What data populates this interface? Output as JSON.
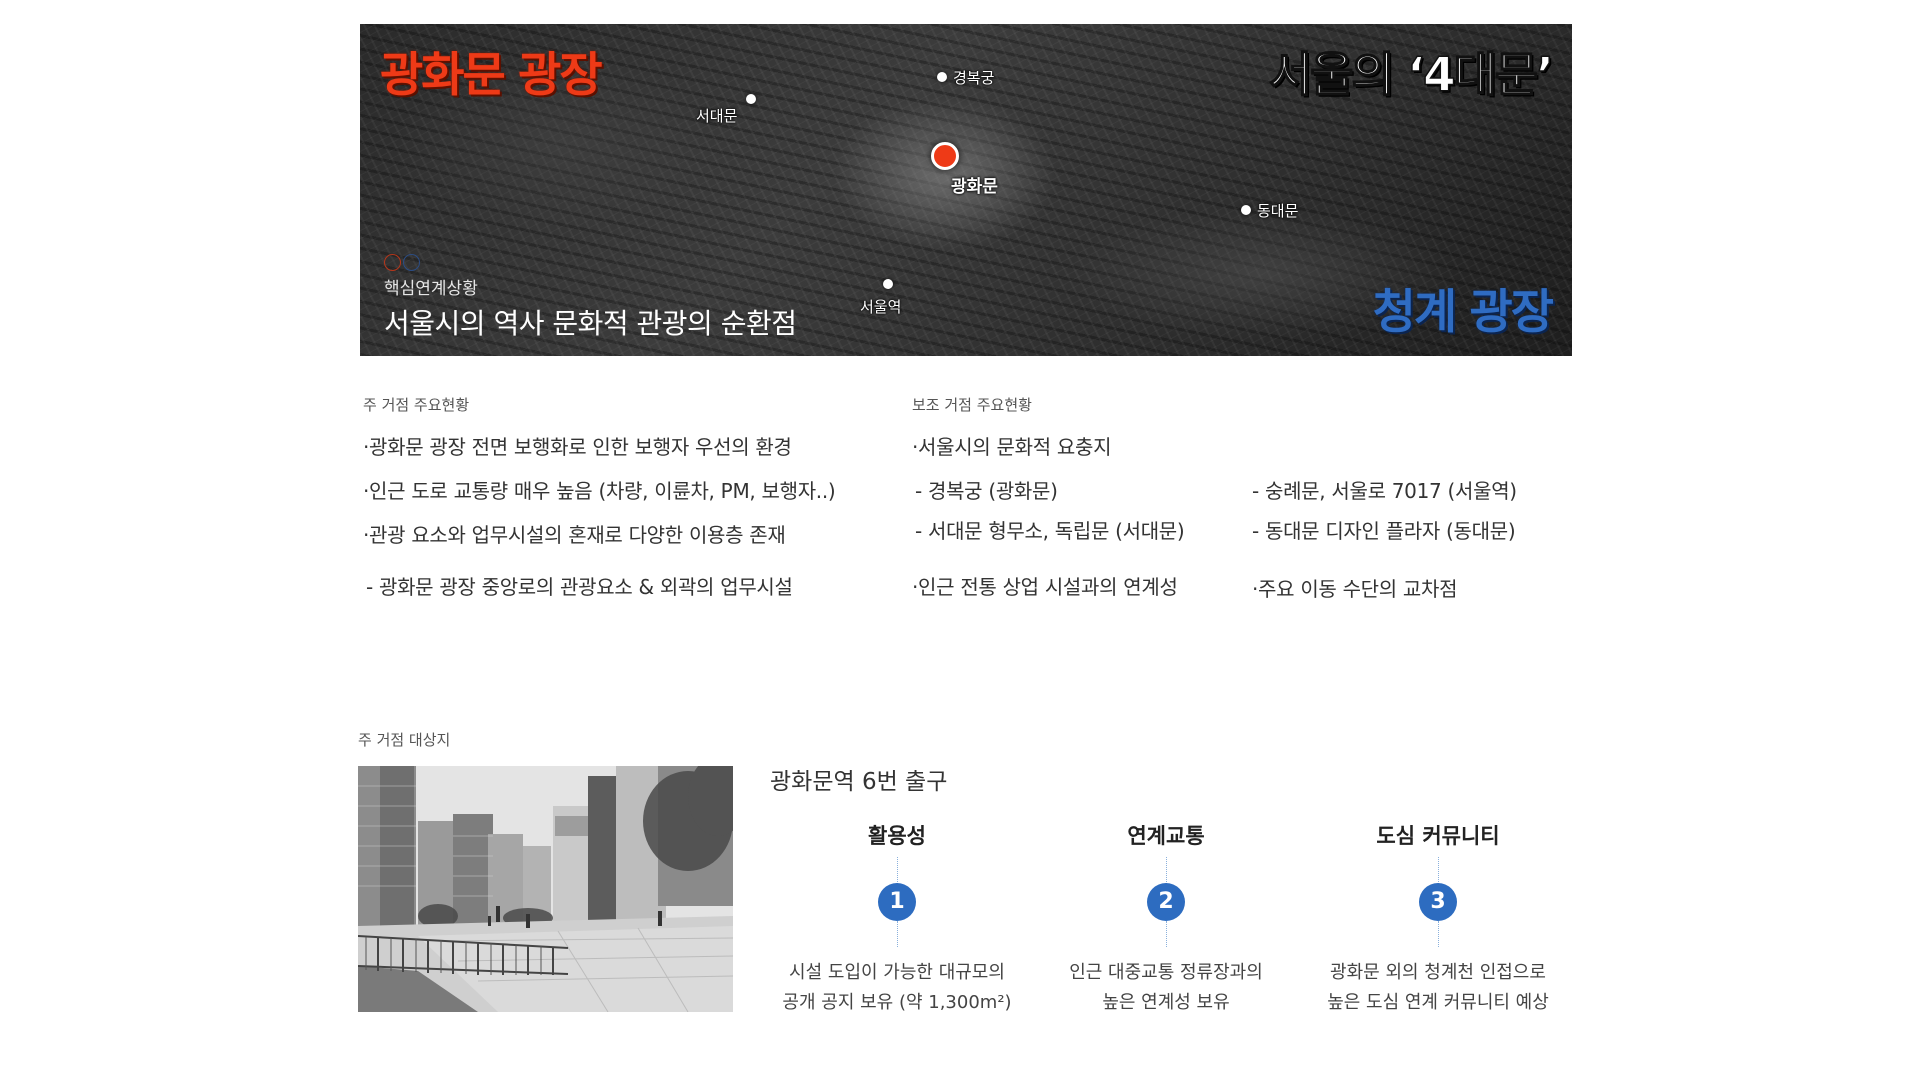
{
  "hero": {
    "title_left": "광화문 광장",
    "title_right": "서울의 ‘4대문’",
    "title_bottom": "청계 광장",
    "locations": {
      "gyeongbokgung": "경복궁",
      "seodaemun": "서대문",
      "gwanghwamun": "광화문",
      "dongdaemun": "동대문",
      "seoul_station": "서울역"
    },
    "subtitle": "핵심연계상황",
    "main_text": "서울시의 역사 문화적 관광의 순환점",
    "colors": {
      "accent_red": "#ee3a17",
      "accent_blue": "#2f6cc2"
    }
  },
  "main_status": {
    "label": "주 거점 주요현황",
    "lines": [
      "·광화문 광장 전면 보행화로 인한 보행자 우선의 환경",
      "·인근 도로 교통량 매우 높음 (차량, 이륜차, PM, 보행자..)",
      "·관광 요소와 업무시설의 혼재로 다양한 이용층 존재",
      "- 광화문 광장 중앙로의 관광요소 & 외곽의 업무시설"
    ]
  },
  "sub_status": {
    "label": "보조 거점 주요현황",
    "heading": "·서울시의 문화적 요충지",
    "items": [
      "- 경복궁 (광화문)",
      "- 서대문 형무소, 독립문 (서대문)",
      "- 숭례문, 서울로 7017 (서울역)",
      "- 동대문 디자인 플라자 (동대문)"
    ],
    "bottom_left": "·인근 전통 상업 시설과의 연계성",
    "bottom_right": "·주요 이동 수단의 교차점"
  },
  "site": {
    "label": "주 거점 대상지",
    "exit_title": "광화문역 6번 출구",
    "features": [
      {
        "num": "1",
        "title": "활용성",
        "desc1": "시설 도입이 가능한 대규모의",
        "desc2": "공개 공지 보유 (약 1,300m²)"
      },
      {
        "num": "2",
        "title": "연계교통",
        "desc1": "인근 대중교통 정류장과의",
        "desc2": "높은 연계성 보유"
      },
      {
        "num": "3",
        "title": "도심 커뮤니티",
        "desc1": "광화문 외의 청계천 인접으로",
        "desc2": "높은 도심 연계 커뮤니티 예상"
      }
    ],
    "badge_color": "#2d6cc0"
  }
}
